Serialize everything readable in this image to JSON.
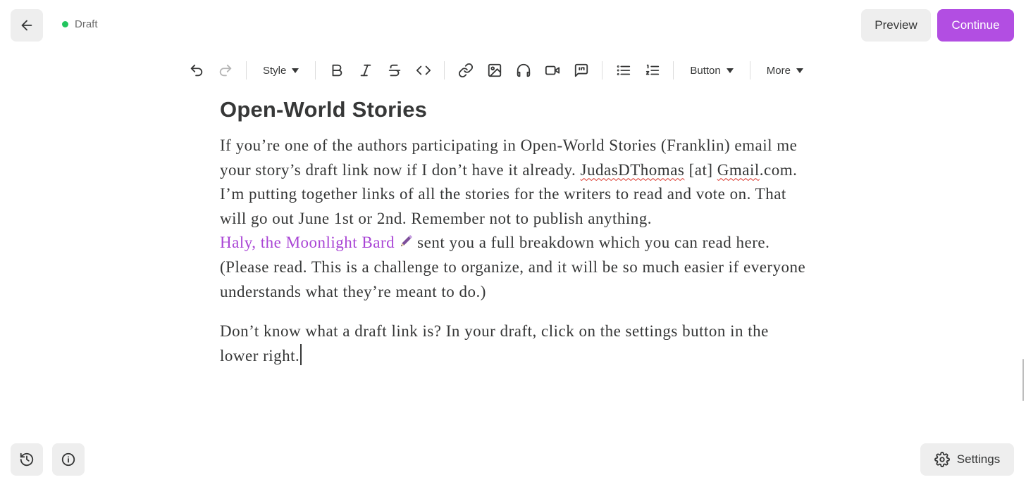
{
  "header": {
    "status_label": "Draft",
    "status_color": "#22c55e",
    "preview_label": "Preview",
    "continue_label": "Continue",
    "accent_color": "#b24ee2"
  },
  "toolbar": {
    "style_label": "Style",
    "button_label": "Button",
    "more_label": "More",
    "icons": [
      "undo-icon",
      "redo-icon",
      "bold-icon",
      "italic-icon",
      "strikethrough-icon",
      "code-icon",
      "link-icon",
      "image-icon",
      "audio-icon",
      "video-icon",
      "pullquote-icon",
      "bullet-list-icon",
      "numbered-list-icon"
    ]
  },
  "document": {
    "title": "Open-World Stories",
    "p1": {
      "l1": "If you’re one of the authors participating in Open-World Stories (Franklin) email me",
      "l2a": "your story’s draft link now if I don’t have it already. ",
      "l2b": "JudasDThomas",
      "l2c": " [at] ",
      "l2d": "Gmail",
      "l2e": ".com.",
      "l3": "I’m putting together links of all the stories for the writers to read and vote on. That",
      "l4": "will go out June 1st or 2nd. Remember not to publish anything.",
      "mention": "Haly, the Moonlight Bard",
      "l5b": "sent you a full breakdown which you can read here.",
      "l6": "(Please read. This is a challenge to organize, and it will be so much easier if everyone",
      "l7": "understands what they’re meant to do.)"
    },
    "p2": {
      "l1": "Don’t know what a draft link is? In your draft, click on the settings button in the",
      "l2": "lower right."
    }
  },
  "footer": {
    "settings_label": "Settings"
  }
}
